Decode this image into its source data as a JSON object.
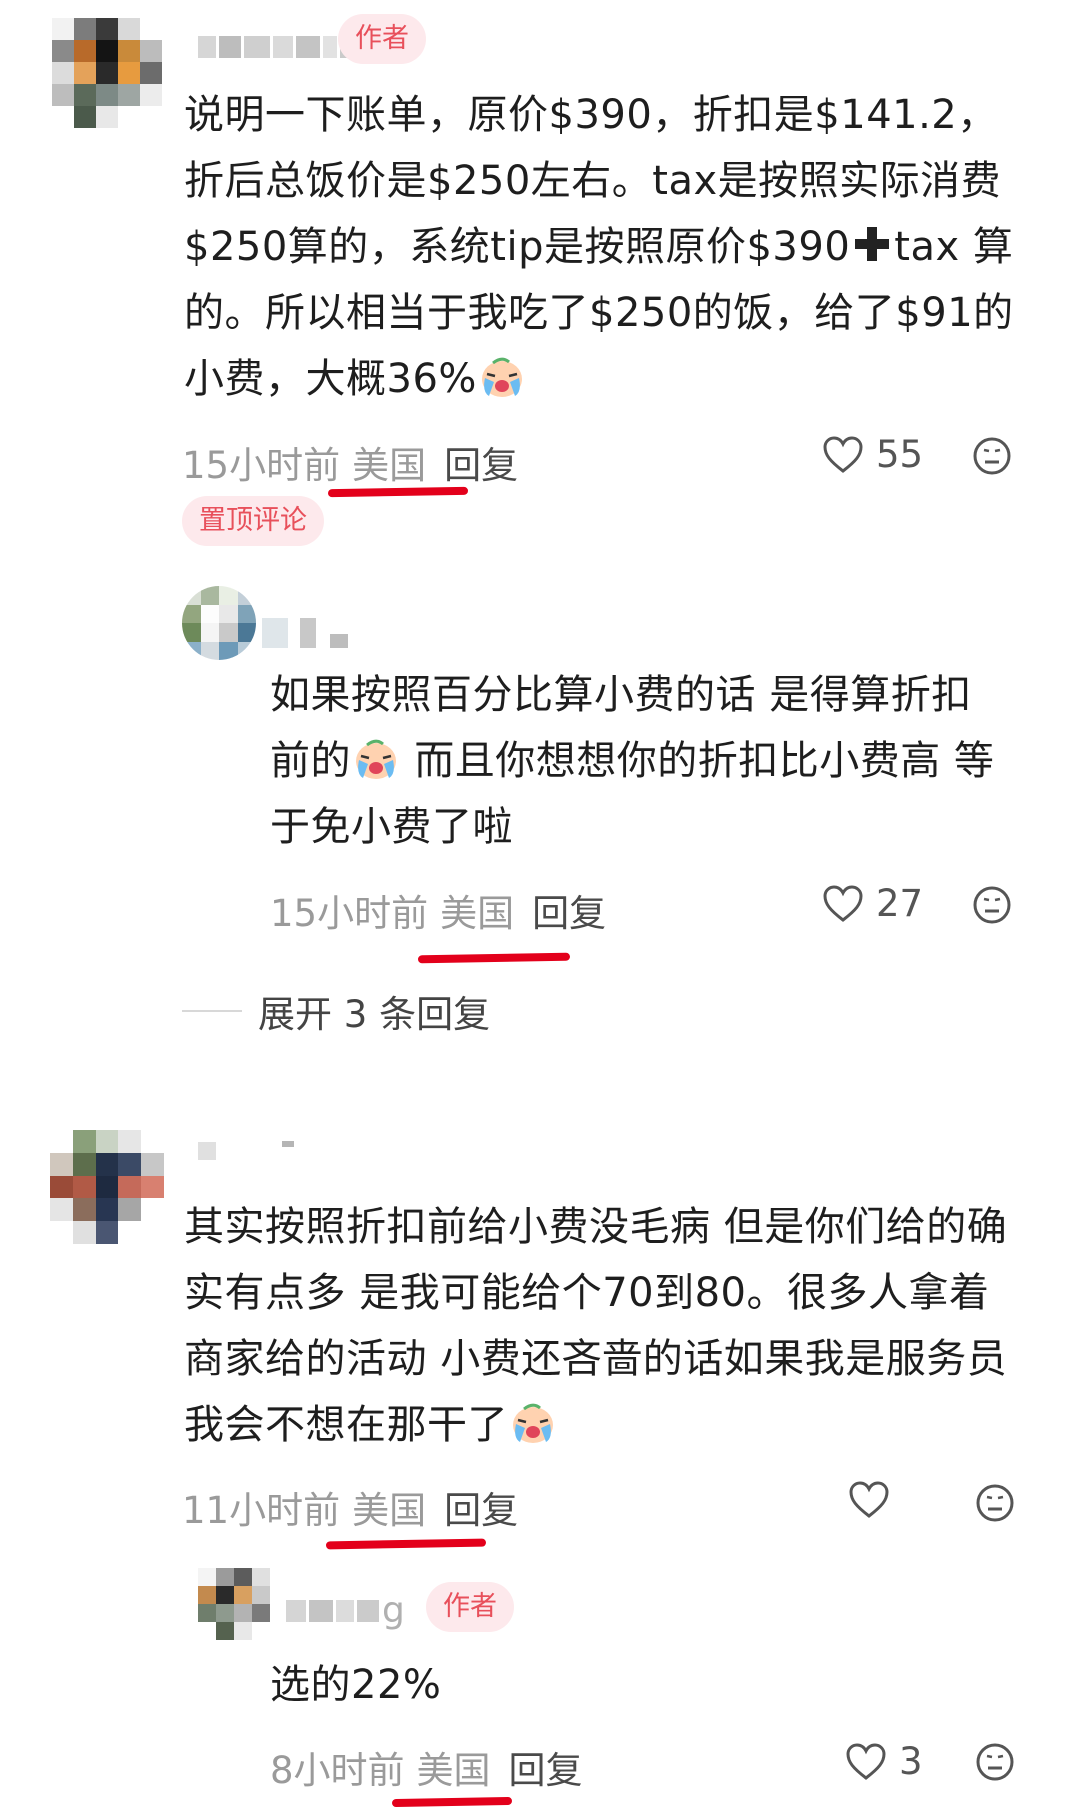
{
  "comments": [
    {
      "author_tag": "作者",
      "lines": [
        "说明一下账单，原价$390，折扣是$141.2，",
        "折后总饭价是$250左右。tax是按照实际消费",
        "$250算的，系统tip是按照原价$390",
        "的。所以相当于我吃了$250的饭，给了$91的",
        "小费，大概36%"
      ],
      "line3_tail": "tax 算",
      "time": "15小时前",
      "location": "美国",
      "reply_label": "回复",
      "likes": "55",
      "pinned_label": "置顶评论"
    },
    {
      "lines": [
        "如果按照百分比算小费的话 是得算折扣",
        "前的",
        "于免小费了啦"
      ],
      "line2_tail": " 而且你想想你的折扣比小费高 等",
      "time": "15小时前",
      "location": "美国",
      "reply_label": "回复",
      "likes": "27"
    },
    {
      "expand_label": "展开 3 条回复"
    },
    {
      "lines": [
        "其实按照折扣前给小费没毛病 但是你们给的确",
        "实有点多 是我可能给个70到80。很多人拿着",
        "商家给的活动 小费还吝啬的话如果我是服务员",
        "我会不想在那干了"
      ],
      "time": "11小时前",
      "location": "美国",
      "reply_label": "回复",
      "likes": ""
    },
    {
      "author_tag": "作者",
      "name_fragment": "g",
      "lines": [
        "选的22%"
      ],
      "time": "8小时前",
      "location": "美国",
      "reply_label": "回复",
      "likes": "3"
    }
  ],
  "icons": {
    "like": "heart-outline-icon",
    "dislike": "neutral-face-icon",
    "emoji": "crying-face-emoji",
    "plus": "heavy-plus-emoji"
  },
  "colors": {
    "accent": "#e8505b",
    "tag_bg": "#fde9ec",
    "annotation_red": "#e3001b",
    "meta_gray": "#9a9a9a"
  }
}
